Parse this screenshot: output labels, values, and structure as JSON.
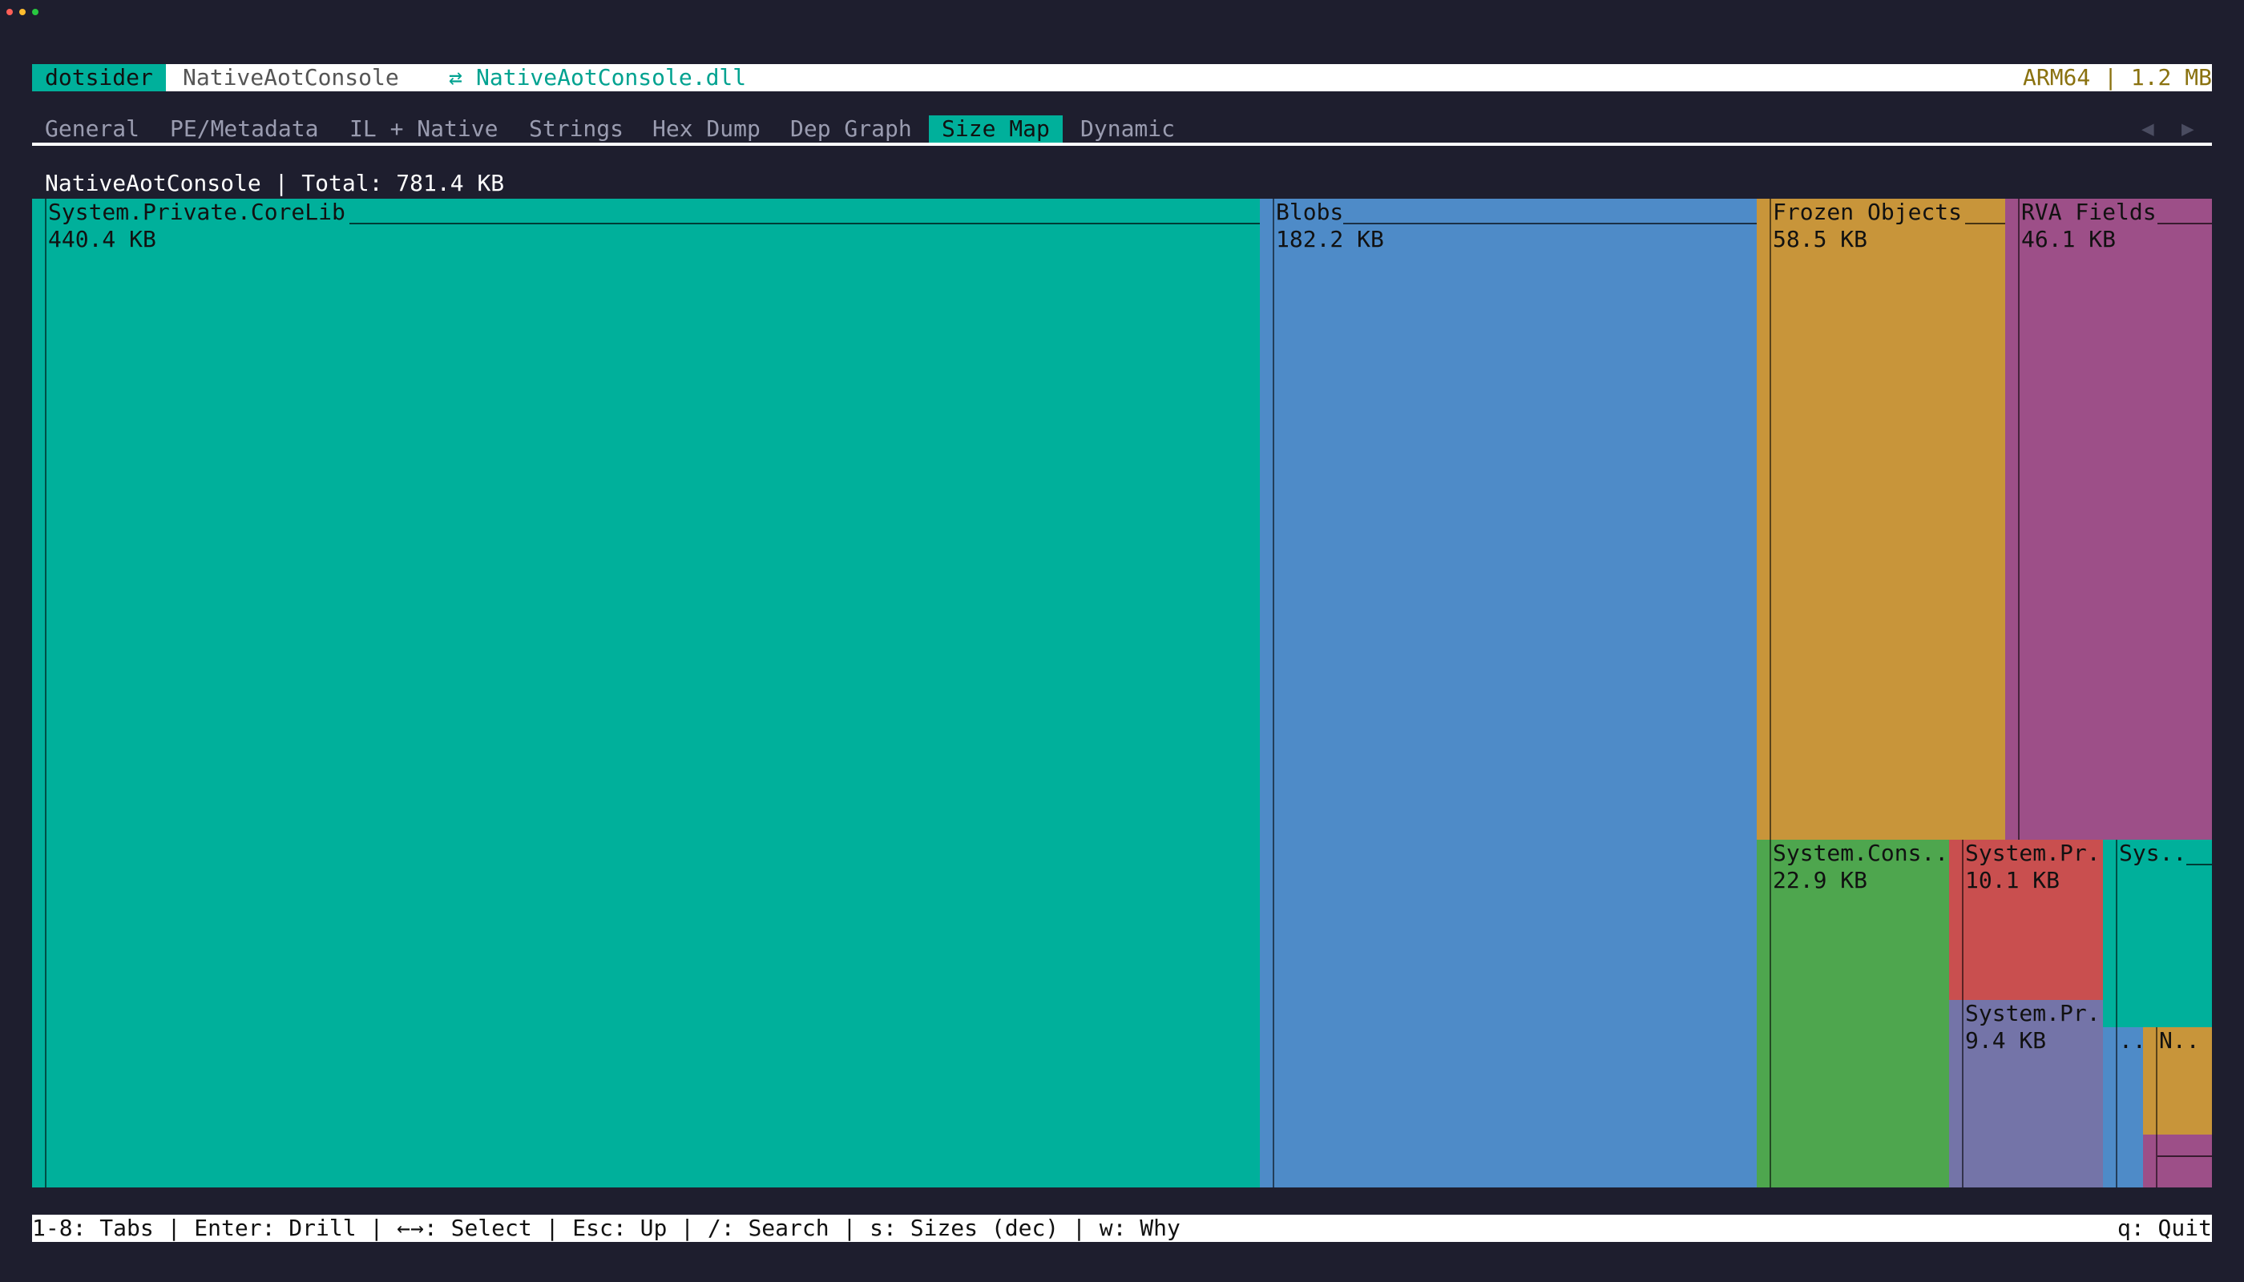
{
  "window": {
    "dots": [
      "#ff5f57",
      "#febc2e",
      "#28c840"
    ]
  },
  "titlebar": {
    "app": "dotsider",
    "project": "NativeAotConsole",
    "swap_symbol": "⇄",
    "file": "NativeAotConsole.dll",
    "arch_size": "ARM64 | 1.2 MB"
  },
  "tabs": {
    "items": [
      "General",
      "PE/Metadata",
      "IL + Native",
      "Strings",
      "Hex Dump",
      "Dep Graph",
      "Size Map",
      "Dynamic"
    ],
    "active": "Size Map",
    "prev_icon": "◀",
    "next_icon": "▶"
  },
  "summary": "NativeAotConsole | Total: 781.4 KB",
  "treemap": {
    "tiles": [
      {
        "name": "System.Private.CoreLib",
        "size": "440.4 KB",
        "color": "#00b09b"
      },
      {
        "name": "Blobs",
        "size": "182.2 KB",
        "color": "#4e8bc8"
      },
      {
        "name": "Frozen Objects",
        "size": "58.5 KB",
        "color": "#c8953a"
      },
      {
        "name": "RVA Fields",
        "size": "46.1 KB",
        "color": "#9d4f88"
      },
      {
        "name": "System.Cons..",
        "size": "22.9 KB",
        "color": "#4ea64e"
      },
      {
        "name": "System.Pr..",
        "size": "10.1 KB",
        "color": "#c94f4f"
      },
      {
        "name": "System.Pr..",
        "size": "9.4 KB",
        "color": "#7474a8"
      },
      {
        "name": "Sys..",
        "size": "",
        "color": "#00b09b"
      },
      {
        "name": "..",
        "size": "",
        "color": "#4e8bc8"
      },
      {
        "name": "N..",
        "size": "",
        "color": "#c8953a"
      },
      {
        "name": "",
        "size": "",
        "color": "#9d4f88"
      }
    ]
  },
  "statusbar": {
    "help": "1-8: Tabs | Enter: Drill | ←→: Select | Esc: Up | /: Search | s: Sizes (dec) | w: Why",
    "quit": "q: Quit"
  }
}
